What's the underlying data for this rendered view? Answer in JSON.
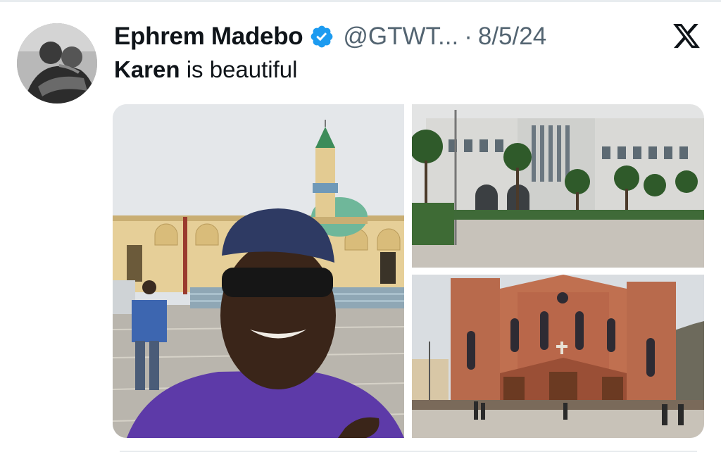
{
  "tweet": {
    "author_name": "Ephrem Madebo",
    "handle": "@GTWT...",
    "separator": "·",
    "date": "8/5/24",
    "text_bold": "Karen",
    "text_rest": " is beautiful"
  },
  "icons": {
    "verified": "verified-badge-icon",
    "platform": "x-logo-icon"
  },
  "colors": {
    "verified_blue": "#1d9bf0",
    "text_primary": "#0f1419",
    "text_secondary": "#536471"
  },
  "media": {
    "count": 3
  }
}
